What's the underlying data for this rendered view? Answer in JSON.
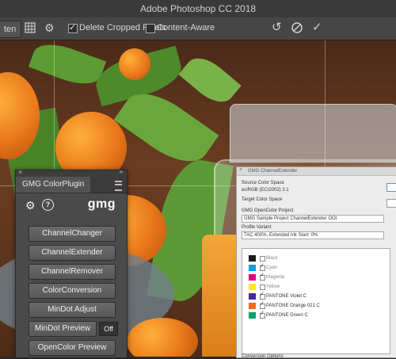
{
  "window": {
    "title": "Adobe Photoshop CC 2018"
  },
  "options_bar": {
    "straighten_label": "ten",
    "delete_cropped_label": "Delete Cropped Pixels",
    "delete_cropped_checked": true,
    "content_aware_label": "Content-Aware",
    "content_aware_checked": false,
    "icons": [
      "overlay-grid-icon",
      "gear-icon",
      "reset-icon",
      "cancel-icon",
      "commit-check-icon"
    ]
  },
  "gmg_panel": {
    "tab_label": "GMG ColorPlugin",
    "logo": "gmg",
    "buttons": [
      "ChannelChanger",
      "ChannelExtender",
      "ChannelRemover",
      "ColorConversion",
      "MinDot Adjust",
      "MinDot Preview",
      "OpenColor Preview"
    ],
    "mindot_state": "Off"
  },
  "dialog": {
    "title": "GMG ChannelExtender",
    "source_label": "Source Color Space",
    "source_value": "eciRGB (ECI2002) 2.1",
    "target_label": "Target Color Space",
    "project_label": "GMG OpenColor Project",
    "project_value": "GMG Sample Project ChannelExtender OOI",
    "profile_label": "Profile Variant",
    "profile_value": "TAC 400%, Extended Ink Start: 0%",
    "inks": [
      {
        "name": "Black",
        "checked": false,
        "dim": true,
        "color": "#1a1a1a"
      },
      {
        "name": "Cyan",
        "checked": true,
        "dim": true,
        "color": "#00a0e3"
      },
      {
        "name": "Magenta",
        "checked": true,
        "dim": true,
        "color": "#e2007a"
      },
      {
        "name": "Yellow",
        "checked": false,
        "dim": true,
        "color": "#ffed00"
      },
      {
        "name": "PANTONE Violet C",
        "checked": true,
        "dim": false,
        "color": "#4a2a96"
      },
      {
        "name": "PANTONE Orange 021 C",
        "checked": true,
        "dim": false,
        "color": "#f26b1d"
      },
      {
        "name": "PANTONE Green C",
        "checked": true,
        "dim": false,
        "color": "#00a36c"
      }
    ],
    "conversion_label": "Conversion Options"
  }
}
